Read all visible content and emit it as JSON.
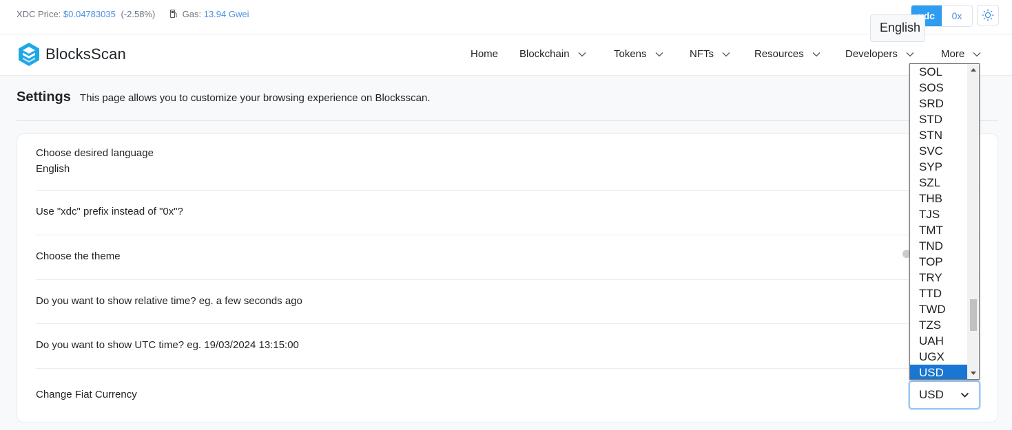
{
  "topbar": {
    "price_label": "XDC Price:",
    "price_value": "$0.04783035",
    "price_change": "(-2.58%)",
    "gas_label": "Gas:",
    "gas_value": "13.94 Gwei",
    "prefix_xdc": "xdc",
    "prefix_0x": "0x",
    "theme_icon": "sun-icon",
    "gas_icon": "gas-pump-icon"
  },
  "brand": {
    "name": "BlocksScan",
    "logo_color": "#1fa7e6"
  },
  "nav": {
    "home": "Home",
    "blockchain": "Blockchain",
    "tokens": "Tokens",
    "nfts": "NFTs",
    "resources": "Resources",
    "developers": "Developers",
    "more": "More"
  },
  "settings": {
    "title": "Settings",
    "description": "This page allows you to customize your browsing experience on Blocksscan.",
    "language_label": "Choose desired language",
    "language_value": "English",
    "language_select_text": "English",
    "prefix_label": "Use \"xdc\" prefix instead of \"0x\"?",
    "theme_label": "Choose the theme",
    "relative_time_label": "Do you want to show relative time? eg. a few seconds ago",
    "utc_label": "Do you want to show UTC time? eg. 19/03/2024 13:15:00",
    "fiat_label": "Change Fiat Currency",
    "fiat_value": "USD"
  },
  "currency_dropdown": {
    "options": [
      "SOL",
      "SOS",
      "SRD",
      "STD",
      "STN",
      "SVC",
      "SYP",
      "SZL",
      "THB",
      "TJS",
      "TMT",
      "TND",
      "TOP",
      "TRY",
      "TTD",
      "TWD",
      "TZS",
      "UAH",
      "UGX",
      "USD"
    ],
    "selected": "USD",
    "highlight_color": "#1976d2"
  },
  "colors": {
    "accent": "#2e9cf0",
    "link": "#4a8fe3"
  }
}
